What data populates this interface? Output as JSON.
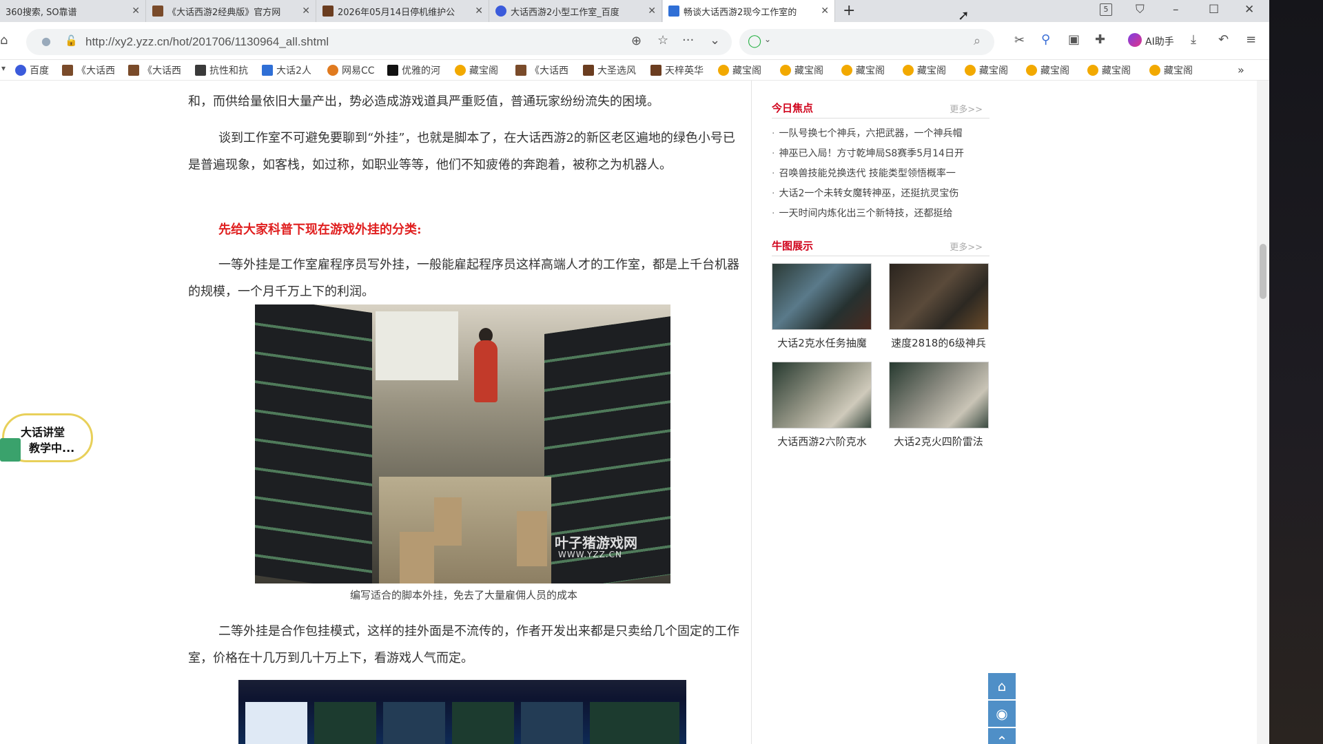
{
  "browser": {
    "tabs": [
      {
        "label": "360搜索, SO靠谱"
      },
      {
        "label": "《大话西游2经典版》官方网"
      },
      {
        "label": "2026年05月14日停机维护公"
      },
      {
        "label": "大话西游2小型工作室_百度"
      },
      {
        "label": "畅谈大话西游2现今工作室的"
      }
    ],
    "url": "http://xy2.yzz.cn/hot/201706/1130964_all.shtml",
    "ai_label": "AI助手",
    "window_badge": "5",
    "bookmarks": [
      {
        "label": "百度"
      },
      {
        "label": "《大话西"
      },
      {
        "label": "《大话西"
      },
      {
        "label": "抗性和抗"
      },
      {
        "label": "大话2人"
      },
      {
        "label": "网易CC"
      },
      {
        "label": "优雅的河"
      },
      {
        "label": "藏宝阁"
      },
      {
        "label": "《大话西"
      },
      {
        "label": "大圣选风"
      },
      {
        "label": "天梓英华"
      },
      {
        "label": "藏宝阁"
      },
      {
        "label": "藏宝阁"
      },
      {
        "label": "藏宝阁"
      },
      {
        "label": "藏宝阁"
      },
      {
        "label": "藏宝阁"
      },
      {
        "label": "藏宝阁"
      },
      {
        "label": "藏宝阁"
      },
      {
        "label": "藏宝阁"
      }
    ],
    "more_bookmarks": "»"
  },
  "article": {
    "p1": "和，而供给量依旧大量产出，势必造成游戏道具严重贬值，普通玩家纷纷流失的困境。",
    "p2": "谈到工作室不可避免要聊到“外挂”，也就是脚本了，在大话西游2的新区老区遍地的绿色小号已是普遍现象，如客栈，如过称，如职业等等，他们不知疲倦的奔跑着，被称之为机器人。",
    "red_heading": "先给大家科普下现在游戏外挂的分类:",
    "p3": "一等外挂是工作室雇程序员写外挂，一般能雇起程序员这样高端人才的工作室，都是上千台机器的规模，一个月千万上下的利润。",
    "image_watermark": "叶子猪游戏网",
    "image_watermark_url": "WWW.YZZ.CN",
    "image_caption": "编写适合的脚本外挂，免去了大量雇佣人员的成本",
    "p4": "二等外挂是合作包挂模式，这样的挂外面是不流传的，作者开发出来都是只卖给几个固定的工作室，价格在十几万到几十万上下，看游戏人气而定。"
  },
  "sidebar": {
    "focus": {
      "title": "今日焦点",
      "more": "更多>>",
      "items": [
        {
          "text": "一队号换七个神兵，六把武器，一个神兵帽"
        },
        {
          "text": "神巫已入局！方寸乾坤局S8赛季5月14日开"
        },
        {
          "text": "召唤兽技能兑换迭代 技能类型领悟概率一"
        },
        {
          "text": "大话2一个未转女魔转神巫，还挺抗灵宝伤"
        },
        {
          "text": "一天时间内炼化出三个新特技，还都挺给"
        }
      ]
    },
    "gallery": {
      "title": "牛图展示",
      "more": "更多>>",
      "items": [
        {
          "label": "大话2克水任务抽魔"
        },
        {
          "label": "速度2818的6级神兵"
        },
        {
          "label": "大话西游2六阶克水"
        },
        {
          "label": "大话2克火四阶雷法"
        }
      ]
    }
  },
  "floating": {
    "badge_line1": "大话讲堂",
    "badge_line2": "教学中..."
  }
}
